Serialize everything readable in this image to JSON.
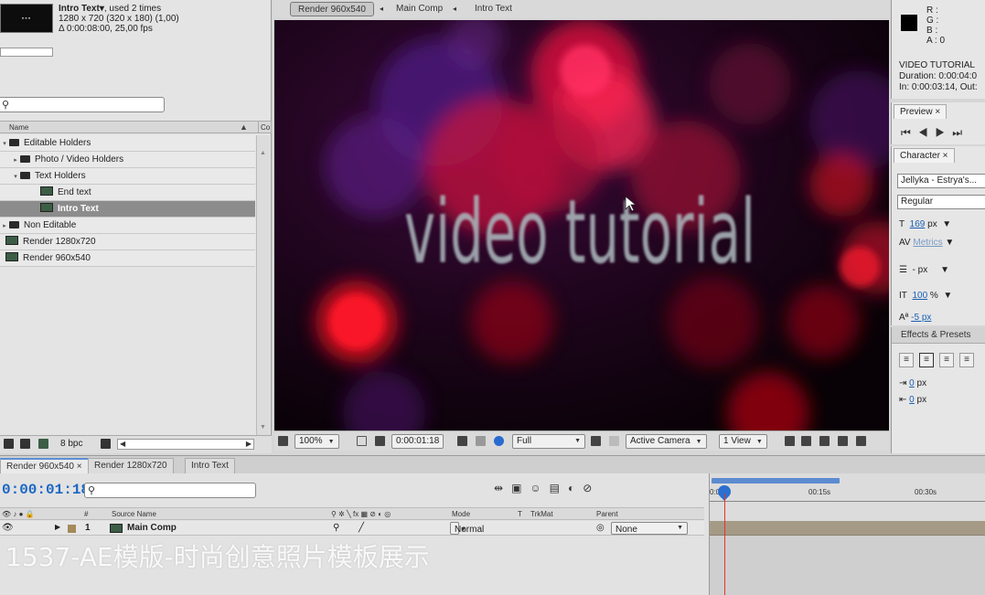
{
  "project": {
    "item_name": "Intro Text▾",
    "item_used": ", used 2 times",
    "item_size": "1280 x 720  (320 x 180) (1,00)",
    "item_duration": "Δ 0:00:08:00, 25,00 fps",
    "column_name": "Name",
    "column_co": "Co",
    "items": [
      {
        "label": "Editable Holders",
        "type": "folder",
        "twirl": "▾"
      },
      {
        "label": "Photo / Video Holders",
        "type": "folder",
        "twirl": "▸"
      },
      {
        "label": "Text Holders",
        "type": "folder",
        "twirl": "▾"
      },
      {
        "label": "End text",
        "type": "comp"
      },
      {
        "label": "Intro Text",
        "type": "comp"
      },
      {
        "label": "Non Editable",
        "type": "folder",
        "twirl": "▸"
      },
      {
        "label": "Render 1280x720",
        "type": "comp"
      },
      {
        "label": "Render 960x540",
        "type": "comp"
      }
    ],
    "bpc": "8 bpc"
  },
  "viewer": {
    "breadcrumb_active": "Render 960x540",
    "breadcrumb_2": "Main Comp",
    "breadcrumb_3": "Intro Text",
    "overlay_text": "video tutorial",
    "zoom": "100%",
    "timecode": "0:00:01:18",
    "resolution": "Full",
    "camera": "Active Camera",
    "views": "1 View"
  },
  "info": {
    "rgba": "R :\nG :\nB :\nA : 0",
    "line1": "VIDEO TUTORIAL",
    "line2": "Duration: 0:00:04:0",
    "line3": "In: 0:00:03:14, Out:"
  },
  "preview": {
    "tab": "Preview ×"
  },
  "character": {
    "tab": "Character ×",
    "font": "Jellyka - Estrya's...",
    "style": "Regular",
    "size_value": "169",
    "size_unit": " px",
    "kerning": "Metrics",
    "leading_unit": "- px",
    "vscale_value": "100",
    "vscale_unit": " %",
    "baseline": "-5 px"
  },
  "effects": {
    "tab": "Effects & Presets",
    "indent1": "0",
    "indent2": "0",
    "unit": " px"
  },
  "timeline": {
    "tabs": [
      "Render 960x540 ×",
      "Render 1280x720",
      "Intro Text"
    ],
    "timecode": "0:00:01:18",
    "col_hash": "#",
    "col_source": "Source Name",
    "col_mode": "Mode",
    "col_t": "T",
    "col_trkmat": "TrkMat",
    "col_parent": "Parent",
    "layer_num": "1",
    "layer_name": "Main Comp",
    "layer_mode": "Normal",
    "layer_parent": "None",
    "ruler": [
      "0:00",
      "00:15s",
      "00:30s"
    ]
  },
  "watermark": "1537-AE模版-时尚创意照片模板展示",
  "colors": {
    "accent": "#1a66c4",
    "selection": "#8c8c8c",
    "cti": "#e2372b"
  }
}
